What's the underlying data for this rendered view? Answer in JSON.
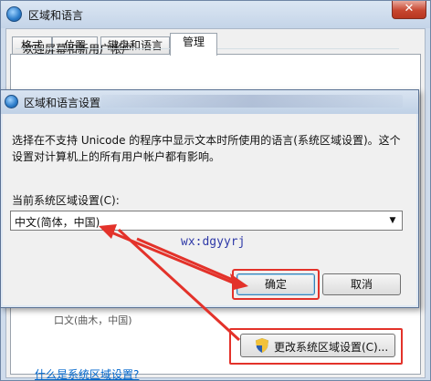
{
  "outer_window": {
    "title": "区域和语言",
    "close_symbol": "✕",
    "tabs": [
      {
        "label": "格式",
        "active": false
      },
      {
        "label": "位置",
        "active": false
      },
      {
        "label": "键盘和语言",
        "active": false
      },
      {
        "label": "管理",
        "active": true
      }
    ],
    "welcome_group_label": "欢迎屏幕和新用户帐户",
    "obscured_text": "口文(曲木，中国)",
    "change_locale_button": "更改系统区域设置(C)...",
    "help_link": "什么是系统区域设置?"
  },
  "dialog": {
    "title": "区域和语言设置",
    "description": "选择在不支持 Unicode 的程序中显示文本时所使用的语言(系统区域设置)。这个设置对计算机上的所有用户帐户都有影响。",
    "current_label": "当前系统区域设置(C):",
    "selected_locale": "中文(简体，中国)",
    "watermark": "wx:dgyyrj",
    "ok_button": "确定",
    "cancel_button": "取消"
  },
  "colors": {
    "highlight": "#e3322a",
    "link": "#0066cc",
    "watermark": "#2f3aa8"
  },
  "icons": [
    "globe-icon",
    "shield-icon",
    "dropdown-arrow-icon",
    "close-icon"
  ]
}
